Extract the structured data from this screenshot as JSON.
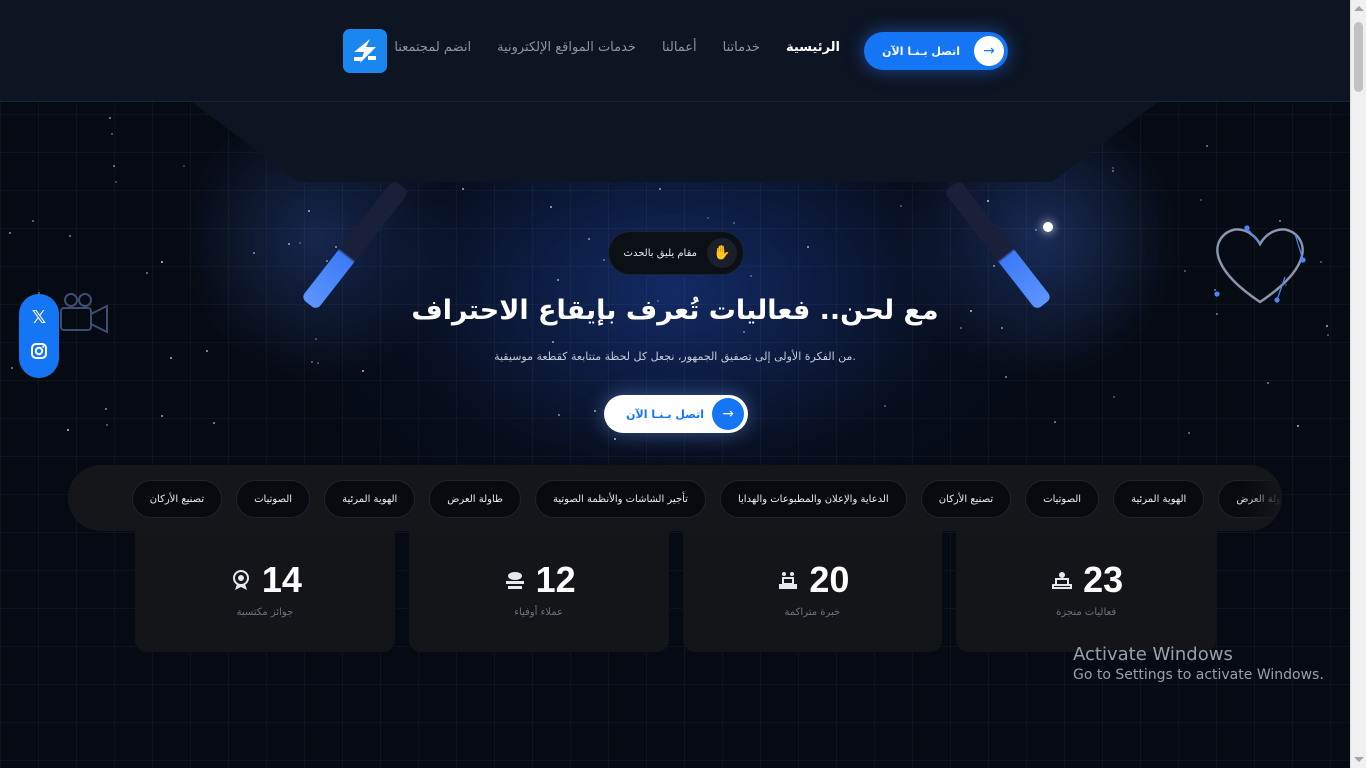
{
  "header": {
    "cta_label": "اتصل بـنـا الآن",
    "nav": [
      {
        "label": "الرئيسية",
        "active": true
      },
      {
        "label": "خدماتنا",
        "active": false
      },
      {
        "label": "أعمالنا",
        "active": false
      },
      {
        "label": "خدمات المواقع الإلكترونية",
        "active": false
      },
      {
        "label": "انضم لمجتمعنا",
        "active": false
      }
    ],
    "logo_icon": "brand-logo-icon"
  },
  "hero": {
    "badge": "مقام يليق بالحدث",
    "badge_icon": "hand-icon",
    "title": "مع لحن.. فعاليات تُعرف بإيقاع الاحتراف",
    "subtitle": "من الفكرة الأولى إلى تصفيق الجمهور، نجعل كل لحظة متتابعة كقطعة موسيقية.",
    "cta_label": "اتصل بـنـا الآن"
  },
  "social": [
    {
      "icon": "x-icon",
      "glyph": "𝕏"
    },
    {
      "icon": "instagram-icon",
      "glyph": "◎"
    }
  ],
  "services": [
    "الهوية المرئية",
    "الصوتيات",
    "تصنيع الأركان",
    "الدعاية والإعلان والمطبوعات والهدايا",
    "تأجير الشاشات والأنظمة الصوتية",
    "طاولة العرض",
    "الهوية المرئية",
    "الصوتيات",
    "تصنيع الأركان"
  ],
  "services_partial": "طاولة العرض",
  "stats": [
    {
      "value": "23",
      "label": "فعاليات منجزة",
      "icon": "stage-icon"
    },
    {
      "value": "20",
      "label": "خبرة متراكمة",
      "icon": "podium-icon"
    },
    {
      "value": "12",
      "label": "عملاء أوفياء",
      "icon": "handshake-icon"
    },
    {
      "value": "14",
      "label": "جوائز مكتسبة",
      "icon": "award-icon"
    }
  ],
  "watermark": {
    "title": "Activate Windows",
    "subtitle": "Go to Settings to activate Windows."
  },
  "colors": {
    "accent": "#1475f5",
    "background": "#060a12",
    "header": "#0d1422"
  }
}
